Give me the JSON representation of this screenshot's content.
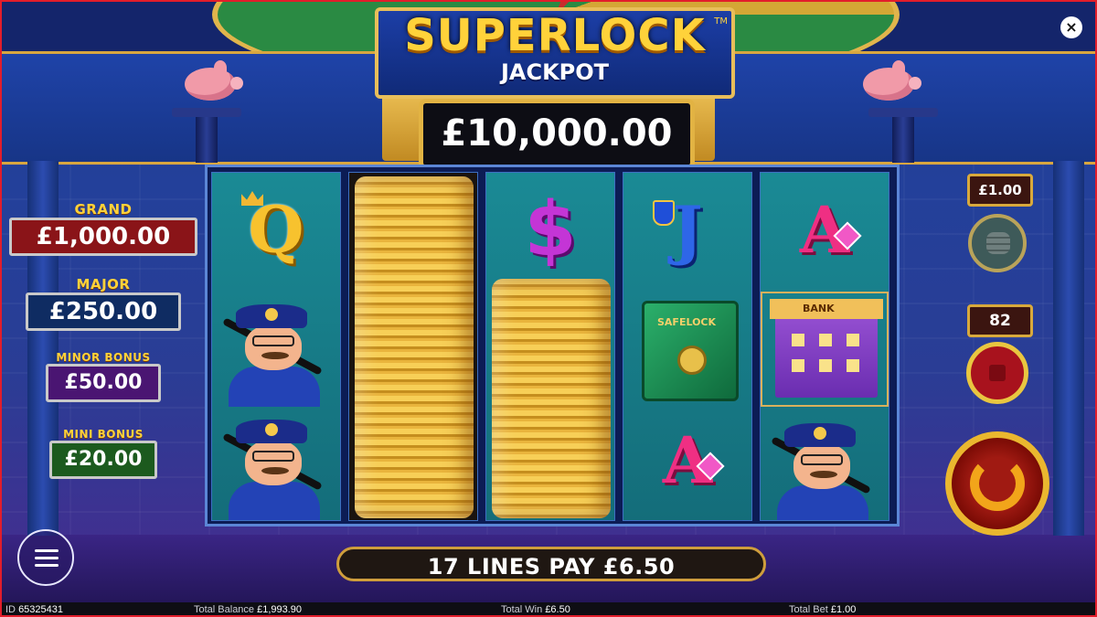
{
  "game": {
    "logo_title": "SUPERLOCK",
    "logo_subtitle": "JACKPOT",
    "logo_tm": "TM",
    "main_jackpot": "£10,000.00"
  },
  "close_label": "×",
  "jackpots": [
    {
      "label": "GRAND",
      "value": "£1,000.00",
      "color": "#8a1418"
    },
    {
      "label": "MAJOR",
      "value": "£250.00",
      "color": "#0f2c62"
    },
    {
      "label": "MINOR BONUS",
      "value": "£50.00",
      "color": "#4a1572"
    },
    {
      "label": "MINI BONUS",
      "value": "£20.00",
      "color": "#1c5a1e"
    }
  ],
  "reels": [
    [
      "Q",
      "policeman",
      "policeman"
    ],
    [
      "coin-stack",
      "coin-stack",
      "coin-stack"
    ],
    [
      "$",
      "coin-stack",
      "coin-stack"
    ],
    [
      "J",
      "safe",
      "A"
    ],
    [
      "A",
      "bank",
      "policeman"
    ]
  ],
  "symbols": {
    "queen": "Q",
    "dollar": "$",
    "jack": "J",
    "ace": "A",
    "safe_label": "SAFELOCK",
    "bank_label": "BANK"
  },
  "controls": {
    "stake": "£1.00",
    "autoplay_count": "82"
  },
  "win_message": "17 LINES PAY £6.50",
  "status": {
    "id_label": "ID",
    "id_value": "65325431",
    "balance_label": "Total Balance",
    "balance_value": "£1,993.90",
    "win_label": "Total Win",
    "win_value": "£6.50",
    "bet_label": "Total Bet",
    "bet_value": "£1.00"
  },
  "colors": {
    "accent_gold": "#e8be5a",
    "frame_red": "#e21d2b",
    "reel_teal": "#1a8a95"
  }
}
